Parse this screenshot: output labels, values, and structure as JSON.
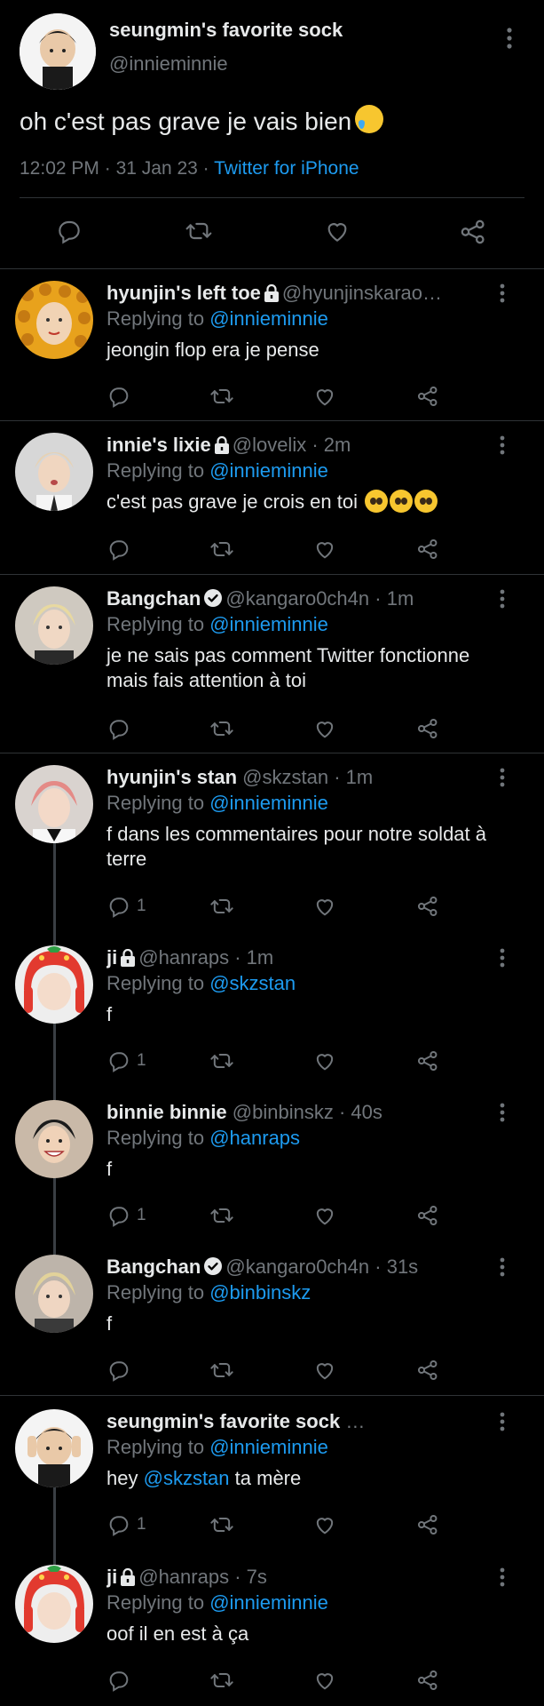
{
  "main_tweet": {
    "display_name": "seungmin's favorite sock",
    "handle": "@inniеminnie",
    "text": "oh c'est pas grave je vais bien",
    "time": "12:02 PM",
    "date": "31 Jan 23",
    "source": "Twitter for iPhone",
    "dot": "·"
  },
  "replying_prefix": "Replying to",
  "colors": {
    "background": "#000000",
    "accent": "#1d9bf0",
    "muted": "#71767b",
    "text": "#e7e9ea",
    "divider": "#2f3336",
    "verified": "#e7e9ea"
  },
  "replies": [
    {
      "name": "hyunjin's left toe",
      "handle": "@hyunjinskarao…",
      "time": "",
      "badge": "lock-icon",
      "replying_to": "@inniеminnie",
      "text": "jeongin flop era je pense",
      "reply_count": ""
    },
    {
      "name": "innie's lixie",
      "handle": "@lovelix",
      "time": "· 2m",
      "badge": "lock-icon",
      "replying_to": "@inniеminnie",
      "text": "c'est pas grave je crois en toi",
      "reply_count": ""
    },
    {
      "name": "Bangchan",
      "handle": "@kangaro0ch4n",
      "time": "· 1m",
      "badge": "verified-icon",
      "replying_to": "@inniеminnie",
      "text": "je ne sais pas comment Twitter fonctionne mais fais attention à toi",
      "reply_count": ""
    },
    {
      "name": "hyunjin's stan",
      "handle": "@skzstan",
      "time": "· 1m",
      "badge": "",
      "replying_to": "@inniеminnie",
      "text": "f dans les commentaires pour notre soldat à terre",
      "reply_count": "1"
    },
    {
      "name": "ji",
      "handle": "@hanraps",
      "time": "· 1m",
      "badge": "lock-icon",
      "replying_to": "@skzstan",
      "text": "f",
      "reply_count": "1"
    },
    {
      "name": "binnie binnie",
      "handle": "@binbinskz",
      "time": "· 40s",
      "badge": "",
      "replying_to": "@hanraps",
      "text": "f",
      "reply_count": "1"
    },
    {
      "name": "Bangchan",
      "handle": "@kangaro0ch4n",
      "time": "· 31s",
      "badge": "verified-icon",
      "replying_to": "@binbinskz",
      "text": "f",
      "reply_count": ""
    },
    {
      "name": "seungmin's favorite sock",
      "handle": "…",
      "time": "",
      "badge": "",
      "replying_to": "@inniеminnie",
      "text_prefix": "hey",
      "text_mention": "@skzstan",
      "text_suffix": "ta mère",
      "reply_count": "1"
    },
    {
      "name": "ji",
      "handle": "@hanraps",
      "time": "· 7s",
      "badge": "lock-icon",
      "replying_to": "@inniеminnie",
      "text": "oof il en est à ça",
      "reply_count": ""
    }
  ]
}
